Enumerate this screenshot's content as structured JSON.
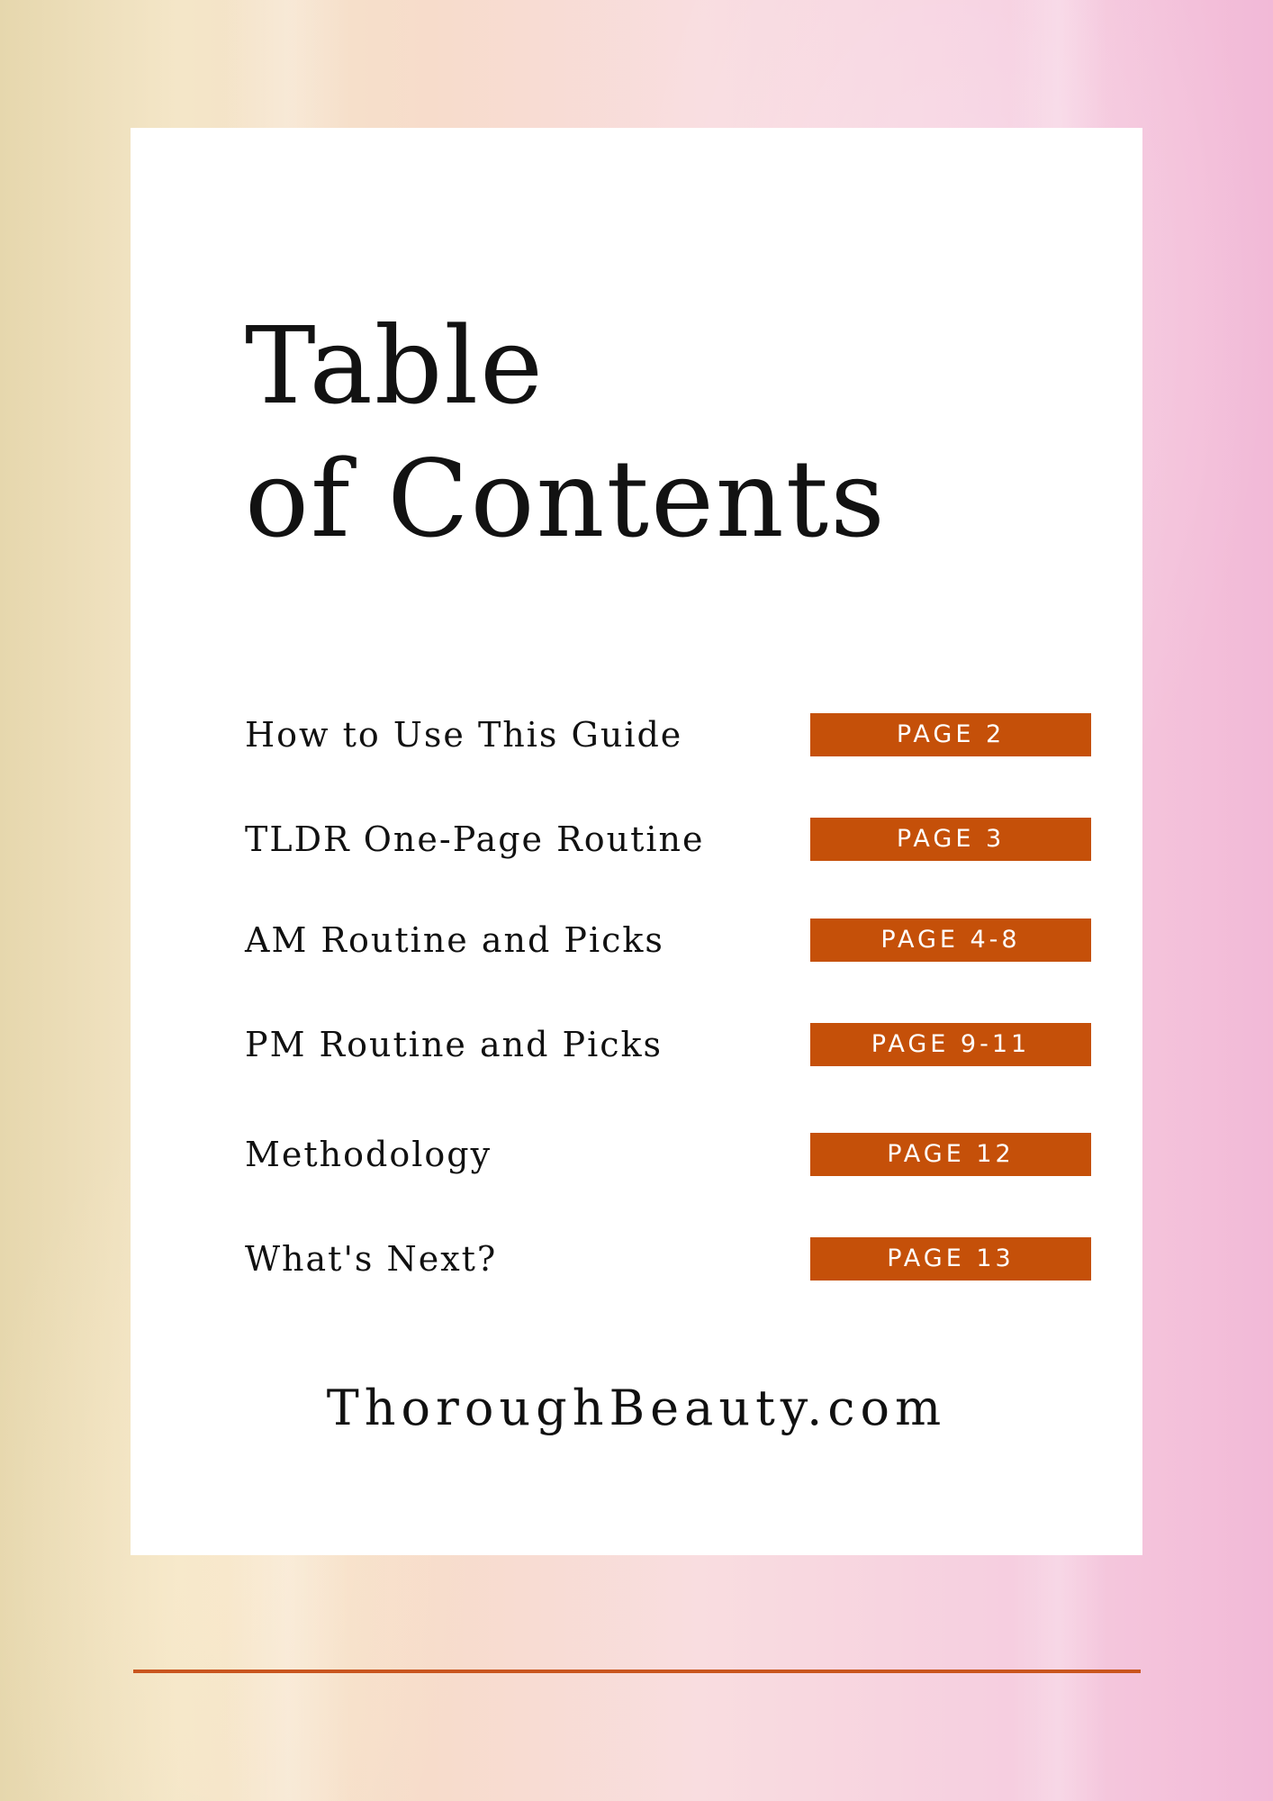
{
  "title": {
    "line1": "Table",
    "line2": "of Contents"
  },
  "toc": [
    {
      "label": "How to Use This Guide",
      "page": "PAGE 2"
    },
    {
      "label": "TLDR One-Page Routine",
      "page": "PAGE 3"
    },
    {
      "label": "AM Routine and Picks",
      "page": "PAGE 4-8"
    },
    {
      "label": "PM Routine and Picks",
      "page": "PAGE 9-11"
    },
    {
      "label": "Methodology",
      "page": "PAGE 12"
    },
    {
      "label": "What's Next?",
      "page": "PAGE 13"
    }
  ],
  "footer": {
    "website": "ThoroughBeauty.com"
  },
  "colors": {
    "accent": "#c55009",
    "text": "#111111",
    "card": "#ffffff"
  }
}
